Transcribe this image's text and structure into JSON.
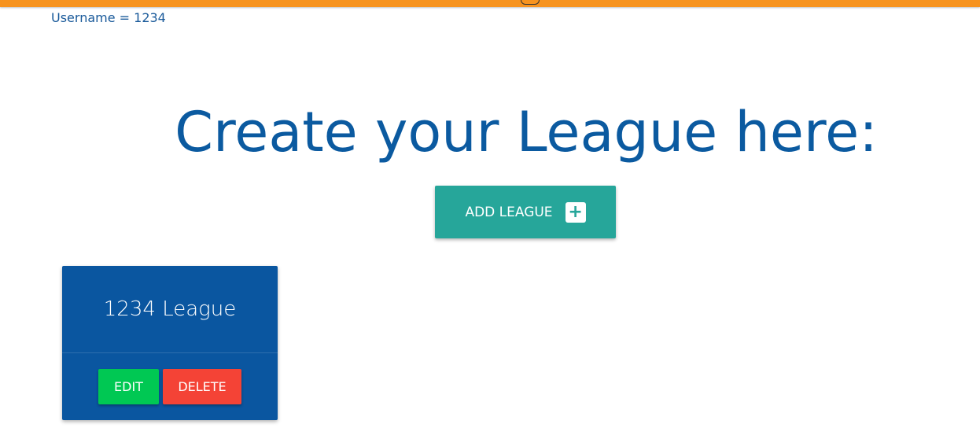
{
  "header": {
    "username_label": "Username = 1234",
    "accent_color": "#f7931e"
  },
  "main": {
    "headline": "Create your League here:",
    "add_button": {
      "label": "ADD LEAGUE",
      "icon": "plus-icon",
      "icon_glyph": "+",
      "color": "#26a69a"
    }
  },
  "leagues": [
    {
      "name": "1234 League",
      "edit_label": "EDIT",
      "delete_label": "DELETE",
      "card_color": "#0a56a0",
      "edit_color": "#00c853",
      "delete_color": "#f44336"
    }
  ]
}
